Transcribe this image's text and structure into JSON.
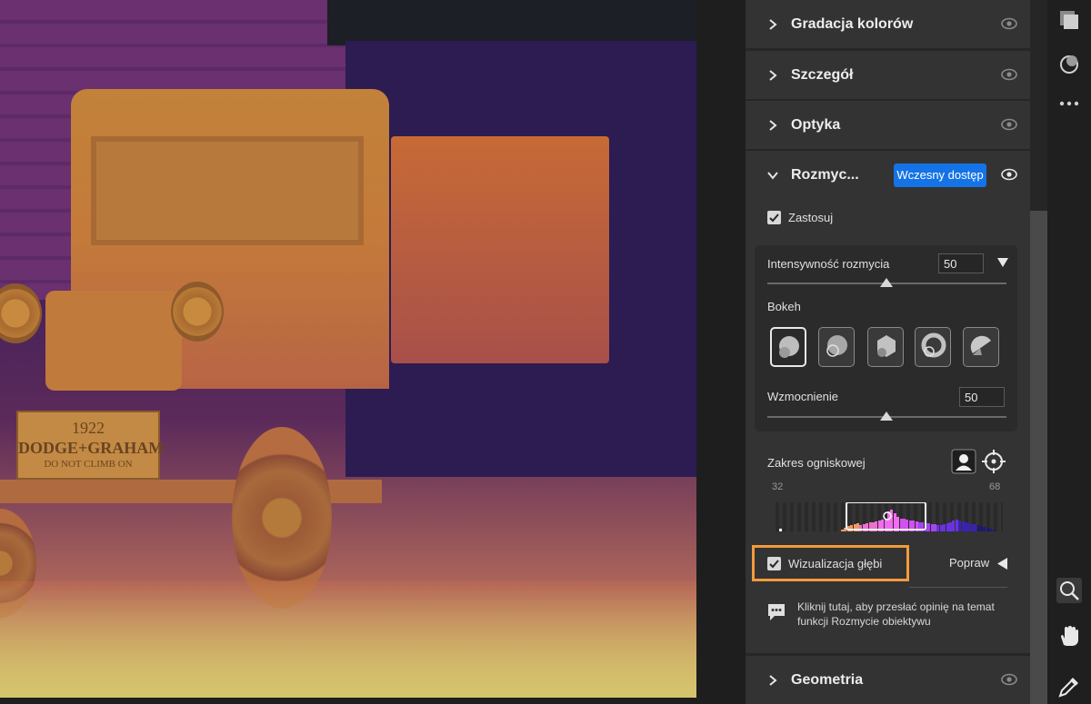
{
  "canvas": {
    "plate_text_1": "1922",
    "plate_text_2": "DODGE+GRAHAM",
    "plate_text_3": "DO NOT CLIMB ON"
  },
  "sections": [
    {
      "title": "Gradacja kolorów",
      "icon": "chevron-right-icon"
    },
    {
      "title": "Szczegół",
      "icon": "chevron-right-icon"
    },
    {
      "title": "Optyka",
      "icon": "chevron-right-icon"
    }
  ],
  "blur": {
    "title": "Rozmyc...",
    "badge": "Wczesny dostęp",
    "apply_label": "Zastosuj",
    "apply_checked": true,
    "intensity_label": "Intensywność rozmycia",
    "intensity_value": "50",
    "bokeh_label": "Bokeh",
    "bokeh_options": [
      "bokeh-circle",
      "bokeh-bubble",
      "bokeh-blade",
      "bokeh-ring",
      "bokeh-cat-eye"
    ],
    "bokeh_selected": 0,
    "boost_label": "Wzmocnienie",
    "boost_value": "50",
    "focal_label": "Zakres ogniskowej",
    "focal_min": "32",
    "focal_max": "68",
    "depth_label": "Wizualizacja głębi",
    "depth_checked": true,
    "refine_label": "Popraw",
    "feedback_text": "Kliknij tutaj, aby przesłać opinię na temat funkcji Rozmycie obiektywu"
  },
  "geometry": {
    "title": "Geometria"
  },
  "colors": {
    "accent_blue": "#1473e6",
    "highlight_orange": "#f39a3c",
    "panel_bg": "#333333"
  }
}
